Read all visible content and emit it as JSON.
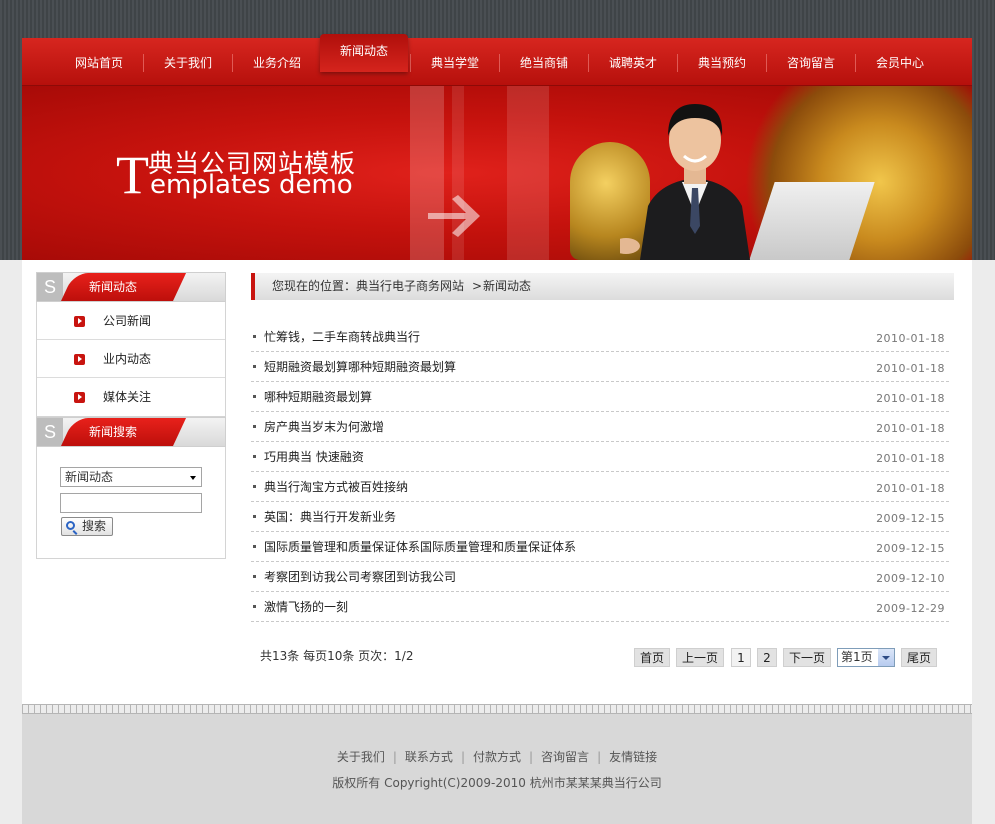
{
  "nav": {
    "items": [
      "网站首页",
      "关于我们",
      "业务介绍",
      "新闻动态",
      "典当学堂",
      "绝当商铺",
      "诚聘英才",
      "典当预约",
      "咨询留言",
      "会员中心"
    ],
    "active": "新闻动态"
  },
  "banner": {
    "title_cn": "典当公司网站模板",
    "title_big_letter": "T",
    "title_en": "emplates demo"
  },
  "sidebar": {
    "s_letter": "S",
    "news_heading": "新闻动态",
    "items": [
      "公司新闻",
      "业内动态",
      "媒体关注"
    ],
    "search_heading": "新闻搜索",
    "search_select_value": "新闻动态",
    "search_input_value": "",
    "search_button_label": "搜索"
  },
  "breadcrumb": {
    "prefix": "您现在的位置：典当行电子商务网站",
    "sep": ">",
    "current": "新闻动态"
  },
  "news": [
    {
      "title": "忙筹钱，二手车商转战典当行",
      "date": "2010-01-18"
    },
    {
      "title": "短期融资最划算哪种短期融资最划算",
      "date": "2010-01-18"
    },
    {
      "title": "哪种短期融资最划算",
      "date": "2010-01-18"
    },
    {
      "title": "房产典当岁末为何激增",
      "date": "2010-01-18"
    },
    {
      "title": "巧用典当 快速融资",
      "date": "2010-01-18"
    },
    {
      "title": "典当行淘宝方式被百姓接纳",
      "date": "2010-01-18"
    },
    {
      "title": "英国：典当行开发新业务",
      "date": "2009-12-15"
    },
    {
      "title": "国际质量管理和质量保证体系国际质量管理和质量保证体系",
      "date": "2009-12-15"
    },
    {
      "title": "考察团到访我公司考察团到访我公司",
      "date": "2009-12-10"
    },
    {
      "title": "激情飞扬的一刻",
      "date": "2009-12-29"
    }
  ],
  "pagination": {
    "info": "共13条  每页10条  页次：1/2",
    "first": "首页",
    "prev": "上一页",
    "pages": [
      "1",
      "2"
    ],
    "next": "下一页",
    "page_select": "第1页",
    "last": "尾页"
  },
  "footer": {
    "links": [
      "关于我们",
      "联系方式",
      "付款方式",
      "咨询留言",
      "友情链接"
    ],
    "link_sep": "|",
    "copyright": "版权所有  Copyright(C)2009-2010 杭州市某某某典当行公司"
  },
  "colors": {
    "brand_red": "#c8140f",
    "footer_bg": "#d8d8d8"
  }
}
